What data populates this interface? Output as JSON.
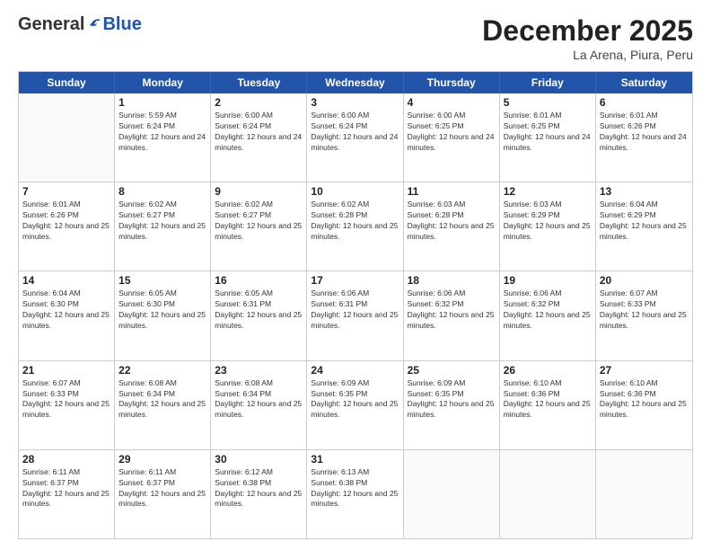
{
  "logo": {
    "general": "General",
    "blue": "Blue"
  },
  "title": "December 2025",
  "subtitle": "La Arena, Piura, Peru",
  "header_days": [
    "Sunday",
    "Monday",
    "Tuesday",
    "Wednesday",
    "Thursday",
    "Friday",
    "Saturday"
  ],
  "weeks": [
    [
      {
        "day": "",
        "empty": true
      },
      {
        "day": "1",
        "sunrise": "Sunrise: 5:59 AM",
        "sunset": "Sunset: 6:24 PM",
        "daylight": "Daylight: 12 hours and 24 minutes."
      },
      {
        "day": "2",
        "sunrise": "Sunrise: 6:00 AM",
        "sunset": "Sunset: 6:24 PM",
        "daylight": "Daylight: 12 hours and 24 minutes."
      },
      {
        "day": "3",
        "sunrise": "Sunrise: 6:00 AM",
        "sunset": "Sunset: 6:24 PM",
        "daylight": "Daylight: 12 hours and 24 minutes."
      },
      {
        "day": "4",
        "sunrise": "Sunrise: 6:00 AM",
        "sunset": "Sunset: 6:25 PM",
        "daylight": "Daylight: 12 hours and 24 minutes."
      },
      {
        "day": "5",
        "sunrise": "Sunrise: 6:01 AM",
        "sunset": "Sunset: 6:25 PM",
        "daylight": "Daylight: 12 hours and 24 minutes."
      },
      {
        "day": "6",
        "sunrise": "Sunrise: 6:01 AM",
        "sunset": "Sunset: 6:26 PM",
        "daylight": "Daylight: 12 hours and 24 minutes."
      }
    ],
    [
      {
        "day": "7",
        "sunrise": "Sunrise: 6:01 AM",
        "sunset": "Sunset: 6:26 PM",
        "daylight": "Daylight: 12 hours and 25 minutes."
      },
      {
        "day": "8",
        "sunrise": "Sunrise: 6:02 AM",
        "sunset": "Sunset: 6:27 PM",
        "daylight": "Daylight: 12 hours and 25 minutes."
      },
      {
        "day": "9",
        "sunrise": "Sunrise: 6:02 AM",
        "sunset": "Sunset: 6:27 PM",
        "daylight": "Daylight: 12 hours and 25 minutes."
      },
      {
        "day": "10",
        "sunrise": "Sunrise: 6:02 AM",
        "sunset": "Sunset: 6:28 PM",
        "daylight": "Daylight: 12 hours and 25 minutes."
      },
      {
        "day": "11",
        "sunrise": "Sunrise: 6:03 AM",
        "sunset": "Sunset: 6:28 PM",
        "daylight": "Daylight: 12 hours and 25 minutes."
      },
      {
        "day": "12",
        "sunrise": "Sunrise: 6:03 AM",
        "sunset": "Sunset: 6:29 PM",
        "daylight": "Daylight: 12 hours and 25 minutes."
      },
      {
        "day": "13",
        "sunrise": "Sunrise: 6:04 AM",
        "sunset": "Sunset: 6:29 PM",
        "daylight": "Daylight: 12 hours and 25 minutes."
      }
    ],
    [
      {
        "day": "14",
        "sunrise": "Sunrise: 6:04 AM",
        "sunset": "Sunset: 6:30 PM",
        "daylight": "Daylight: 12 hours and 25 minutes."
      },
      {
        "day": "15",
        "sunrise": "Sunrise: 6:05 AM",
        "sunset": "Sunset: 6:30 PM",
        "daylight": "Daylight: 12 hours and 25 minutes."
      },
      {
        "day": "16",
        "sunrise": "Sunrise: 6:05 AM",
        "sunset": "Sunset: 6:31 PM",
        "daylight": "Daylight: 12 hours and 25 minutes."
      },
      {
        "day": "17",
        "sunrise": "Sunrise: 6:06 AM",
        "sunset": "Sunset: 6:31 PM",
        "daylight": "Daylight: 12 hours and 25 minutes."
      },
      {
        "day": "18",
        "sunrise": "Sunrise: 6:06 AM",
        "sunset": "Sunset: 6:32 PM",
        "daylight": "Daylight: 12 hours and 25 minutes."
      },
      {
        "day": "19",
        "sunrise": "Sunrise: 6:06 AM",
        "sunset": "Sunset: 6:32 PM",
        "daylight": "Daylight: 12 hours and 25 minutes."
      },
      {
        "day": "20",
        "sunrise": "Sunrise: 6:07 AM",
        "sunset": "Sunset: 6:33 PM",
        "daylight": "Daylight: 12 hours and 25 minutes."
      }
    ],
    [
      {
        "day": "21",
        "sunrise": "Sunrise: 6:07 AM",
        "sunset": "Sunset: 6:33 PM",
        "daylight": "Daylight: 12 hours and 25 minutes."
      },
      {
        "day": "22",
        "sunrise": "Sunrise: 6:08 AM",
        "sunset": "Sunset: 6:34 PM",
        "daylight": "Daylight: 12 hours and 25 minutes."
      },
      {
        "day": "23",
        "sunrise": "Sunrise: 6:08 AM",
        "sunset": "Sunset: 6:34 PM",
        "daylight": "Daylight: 12 hours and 25 minutes."
      },
      {
        "day": "24",
        "sunrise": "Sunrise: 6:09 AM",
        "sunset": "Sunset: 6:35 PM",
        "daylight": "Daylight: 12 hours and 25 minutes."
      },
      {
        "day": "25",
        "sunrise": "Sunrise: 6:09 AM",
        "sunset": "Sunset: 6:35 PM",
        "daylight": "Daylight: 12 hours and 25 minutes."
      },
      {
        "day": "26",
        "sunrise": "Sunrise: 6:10 AM",
        "sunset": "Sunset: 6:36 PM",
        "daylight": "Daylight: 12 hours and 25 minutes."
      },
      {
        "day": "27",
        "sunrise": "Sunrise: 6:10 AM",
        "sunset": "Sunset: 6:36 PM",
        "daylight": "Daylight: 12 hours and 25 minutes."
      }
    ],
    [
      {
        "day": "28",
        "sunrise": "Sunrise: 6:11 AM",
        "sunset": "Sunset: 6:37 PM",
        "daylight": "Daylight: 12 hours and 25 minutes."
      },
      {
        "day": "29",
        "sunrise": "Sunrise: 6:11 AM",
        "sunset": "Sunset: 6:37 PM",
        "daylight": "Daylight: 12 hours and 25 minutes."
      },
      {
        "day": "30",
        "sunrise": "Sunrise: 6:12 AM",
        "sunset": "Sunset: 6:38 PM",
        "daylight": "Daylight: 12 hours and 25 minutes."
      },
      {
        "day": "31",
        "sunrise": "Sunrise: 6:13 AM",
        "sunset": "Sunset: 6:38 PM",
        "daylight": "Daylight: 12 hours and 25 minutes."
      },
      {
        "day": "",
        "empty": true
      },
      {
        "day": "",
        "empty": true
      },
      {
        "day": "",
        "empty": true
      }
    ]
  ]
}
